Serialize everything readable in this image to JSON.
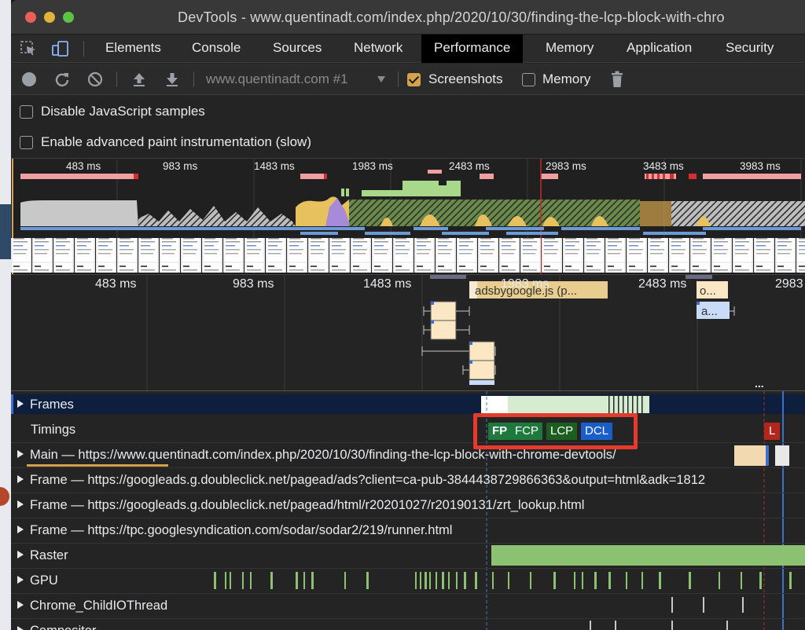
{
  "window": {
    "title": "DevTools - www.quentinadt.com/index.php/2020/10/30/finding-the-lcp-block-with-chro"
  },
  "tabs": [
    "Elements",
    "Console",
    "Sources",
    "Network",
    "Performance",
    "Memory",
    "Application",
    "Security"
  ],
  "active_tab": "Performance",
  "toolbar": {
    "record_icon": "record-icon",
    "reload_icon": "reload-icon",
    "clear_icon": "clear-icon",
    "upload_icon": "upload-icon",
    "download_icon": "download-icon",
    "profile_select": "www.quentinadt.com #1",
    "screenshots_label": "Screenshots",
    "screenshots_checked": true,
    "memory_label": "Memory",
    "memory_checked": false,
    "trash_icon": "trash-icon"
  },
  "settings": {
    "disable_js_samples": "Disable JavaScript samples",
    "advanced_paint": "Enable advanced paint instrumentation (slow)"
  },
  "overview": {
    "ticks": [
      "483 ms",
      "983 ms",
      "1483 ms",
      "1983 ms",
      "2483 ms",
      "2983 ms",
      "3483 ms",
      "3983 ms"
    ]
  },
  "flame": {
    "ticks": [
      "483 ms",
      "983 ms",
      "1483 ms",
      "1983 ms",
      "2483 ms",
      "2983"
    ],
    "blocks": [
      "adsbygoogle.js (p...",
      "o...",
      "a..."
    ],
    "more": "..."
  },
  "tracks": {
    "frames": "Frames",
    "timings": "Timings",
    "main": "Main — https://www.quentinadt.com/index.php/2020/10/30/finding-the-lcp-block-with-chrome-devtools/",
    "frame1": "Frame — https://googleads.g.doubleclick.net/pagead/ads?client=ca-pub-3844438729866363&output=html&adk=1812",
    "frame2": "Frame — https://googleads.g.doubleclick.net/pagead/html/r20201027/r20190131/zrt_lookup.html",
    "frame3": "Frame — https://tpc.googlesyndication.com/sodar/sodar2/219/runner.html",
    "raster": "Raster",
    "gpu": "GPU",
    "childio": "Chrome_ChildIOThread",
    "compositor": "Compositor"
  },
  "markers": {
    "fp": "FP",
    "fcp": "FCP",
    "lcp": "LCP",
    "dcl": "DCL",
    "l": "L"
  },
  "colors": {
    "fp": "#1e7a3c",
    "fcp": "#1e7a3c",
    "lcp": "#1b5e20",
    "dcl": "#1a5fc9",
    "l": "#b3261e",
    "highlight": "#e53a2c",
    "scripting": "#e7c15e",
    "rendering": "#a78ad8",
    "painting": "#7fbf6a",
    "idle": "#c8c8c8",
    "network": "#6b9ad8",
    "accent": "#d4a24c"
  }
}
